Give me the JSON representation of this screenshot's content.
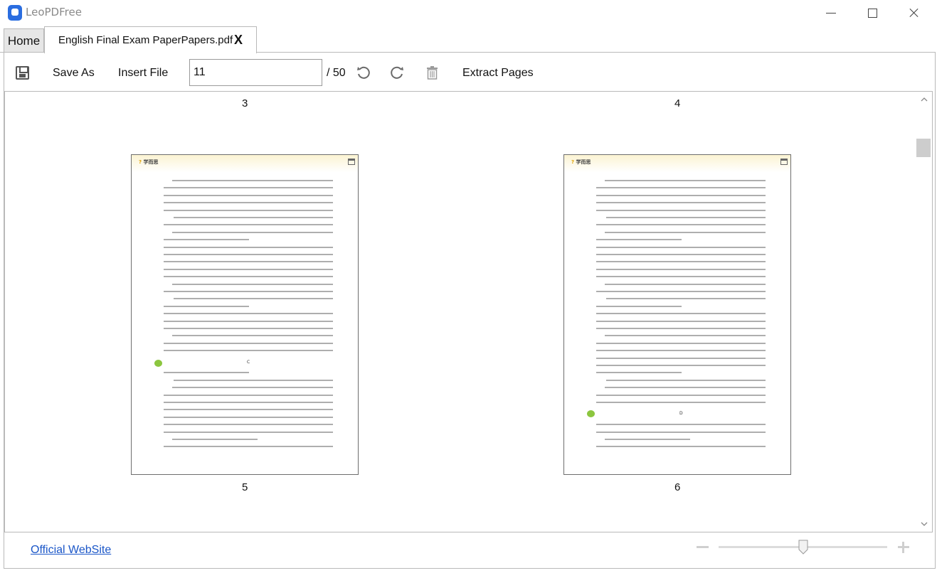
{
  "window": {
    "app_title": "LeoPDFree"
  },
  "tabs": {
    "home_label": "Home",
    "doc_label": "English Final Exam PaperPapers.pdf",
    "doc_close": "X"
  },
  "toolbar": {
    "save_as": "Save As",
    "insert_file": "Insert File",
    "page_value": "11",
    "page_total": "/ 50",
    "extract_pages": "Extract Pages"
  },
  "viewer": {
    "top_page_left": "3",
    "top_page_right": "4",
    "pages": [
      {
        "label": "5",
        "brand": "学而思",
        "letter": "C"
      },
      {
        "label": "6",
        "brand": "学而思",
        "letter": "D"
      }
    ]
  },
  "footer": {
    "official_link": "Official WebSite"
  },
  "colors": {
    "link": "#1a56c8",
    "logo": "#2a6de0",
    "badge": "#8cc63f"
  }
}
